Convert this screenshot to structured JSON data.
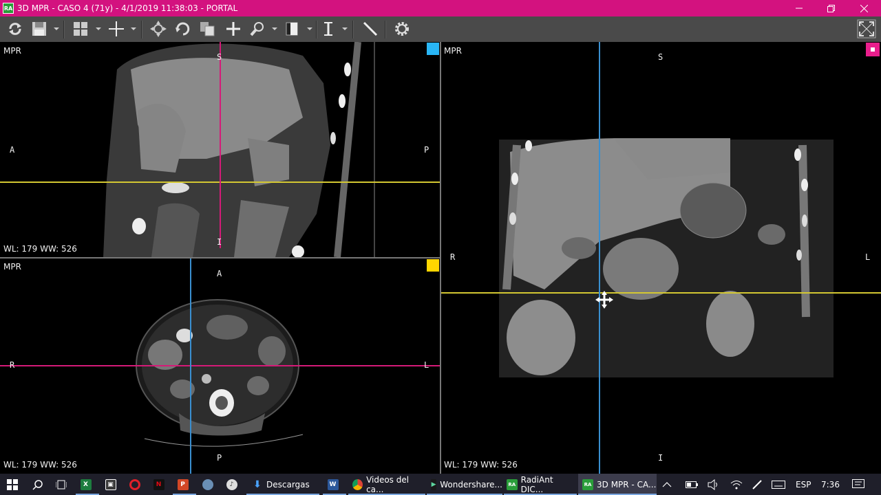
{
  "window": {
    "title": "3D MPR - CASO 4 (71y) - 4/1/2019 11:38:03 - PORTAL",
    "app_icon": "RA",
    "min_icon": "minimize-icon",
    "max_icon": "restore-icon",
    "close_icon": "close-icon",
    "accent": "#d3127f"
  },
  "toolbar": {
    "tools": [
      "reset-icon",
      "save-icon",
      "layout-icon",
      "crosshair-icon",
      "pan-icon",
      "rotate-icon",
      "copy-icon",
      "move-icon",
      "zoom-icon",
      "window-level-icon",
      "slab-thickness-icon",
      "measure-icon",
      "settings-icon",
      "fullscreen-icon"
    ]
  },
  "viewports": {
    "sagittal": {
      "label": "MPR",
      "top": "S",
      "bottom": "I",
      "left": "A",
      "right": "P",
      "wl": "WL: 179 WW: 526",
      "marker_color": "#29b6f6"
    },
    "axial": {
      "label": "MPR",
      "top": "A",
      "bottom": "P",
      "left": "R",
      "right": "L",
      "wl": "WL: 179 WW: 526",
      "marker_color": "#ffd600"
    },
    "coronal": {
      "label": "MPR",
      "top": "S",
      "bottom": "I",
      "left": "R",
      "right": "L",
      "wl": "WL: 179 WW: 526",
      "marker_color": "#e91e8c"
    }
  },
  "crosshair_colors": {
    "yellow": "#d4c832",
    "magenta": "#d61a78",
    "blue": "#3a8fd0"
  },
  "taskbar": {
    "items": [
      {
        "icon": "excel-icon",
        "label": ""
      },
      {
        "icon": "store-icon",
        "label": ""
      },
      {
        "icon": "opera-icon",
        "label": ""
      },
      {
        "icon": "netflix-icon",
        "label": ""
      },
      {
        "icon": "powerpoint-icon",
        "label": ""
      },
      {
        "icon": "app-icon",
        "label": ""
      },
      {
        "icon": "music-icon",
        "label": ""
      },
      {
        "icon": "download-icon",
        "label": "Descargas"
      },
      {
        "icon": "word-icon",
        "label": ""
      },
      {
        "icon": "chrome-icon",
        "label": "Videos del ca..."
      },
      {
        "icon": "wondershare-icon",
        "label": "Wondershare..."
      },
      {
        "icon": "radiant-icon",
        "label": "RadiAnt DIC..."
      },
      {
        "icon": "radiant-icon",
        "label": "3D MPR - CA..."
      }
    ],
    "lang": "ESP",
    "time": "7:36"
  }
}
